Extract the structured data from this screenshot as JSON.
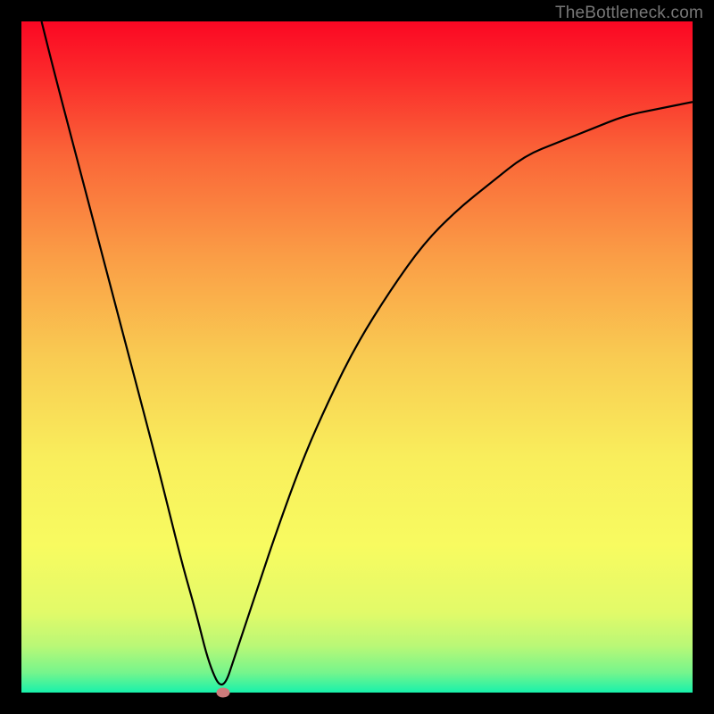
{
  "watermark": "TheBottleneck.com",
  "chart_data": {
    "type": "line",
    "title": "",
    "xlabel": "",
    "ylabel": "",
    "xlim": [
      0,
      100
    ],
    "ylim": [
      0,
      100
    ],
    "series": [
      {
        "name": "bottleneck-curve",
        "x": [
          3,
          5,
          10,
          15,
          20,
          22,
          24,
          26,
          28,
          30,
          32,
          35,
          38,
          42,
          46,
          50,
          55,
          60,
          65,
          70,
          75,
          80,
          85,
          90,
          95,
          100
        ],
        "y": [
          100,
          92,
          73,
          54,
          35,
          27,
          19,
          12,
          4,
          0,
          6,
          15,
          24,
          35,
          44,
          52,
          60,
          67,
          72,
          76,
          80,
          82,
          84,
          86,
          87,
          88
        ]
      }
    ],
    "marker": {
      "name": "optimal-point",
      "x": 30,
      "y": 0
    },
    "background_gradient": {
      "stops": [
        {
          "offset": 0.0,
          "color": "#fb0723"
        },
        {
          "offset": 0.08,
          "color": "#fb2a2b"
        },
        {
          "offset": 0.2,
          "color": "#fa6638"
        },
        {
          "offset": 0.35,
          "color": "#fa9d46"
        },
        {
          "offset": 0.5,
          "color": "#f9cb52"
        },
        {
          "offset": 0.65,
          "color": "#f9ee5c"
        },
        {
          "offset": 0.78,
          "color": "#f8fb60"
        },
        {
          "offset": 0.88,
          "color": "#e2fa69"
        },
        {
          "offset": 0.93,
          "color": "#baf876"
        },
        {
          "offset": 0.97,
          "color": "#76f58c"
        },
        {
          "offset": 1.0,
          "color": "#18f1ab"
        }
      ]
    }
  }
}
